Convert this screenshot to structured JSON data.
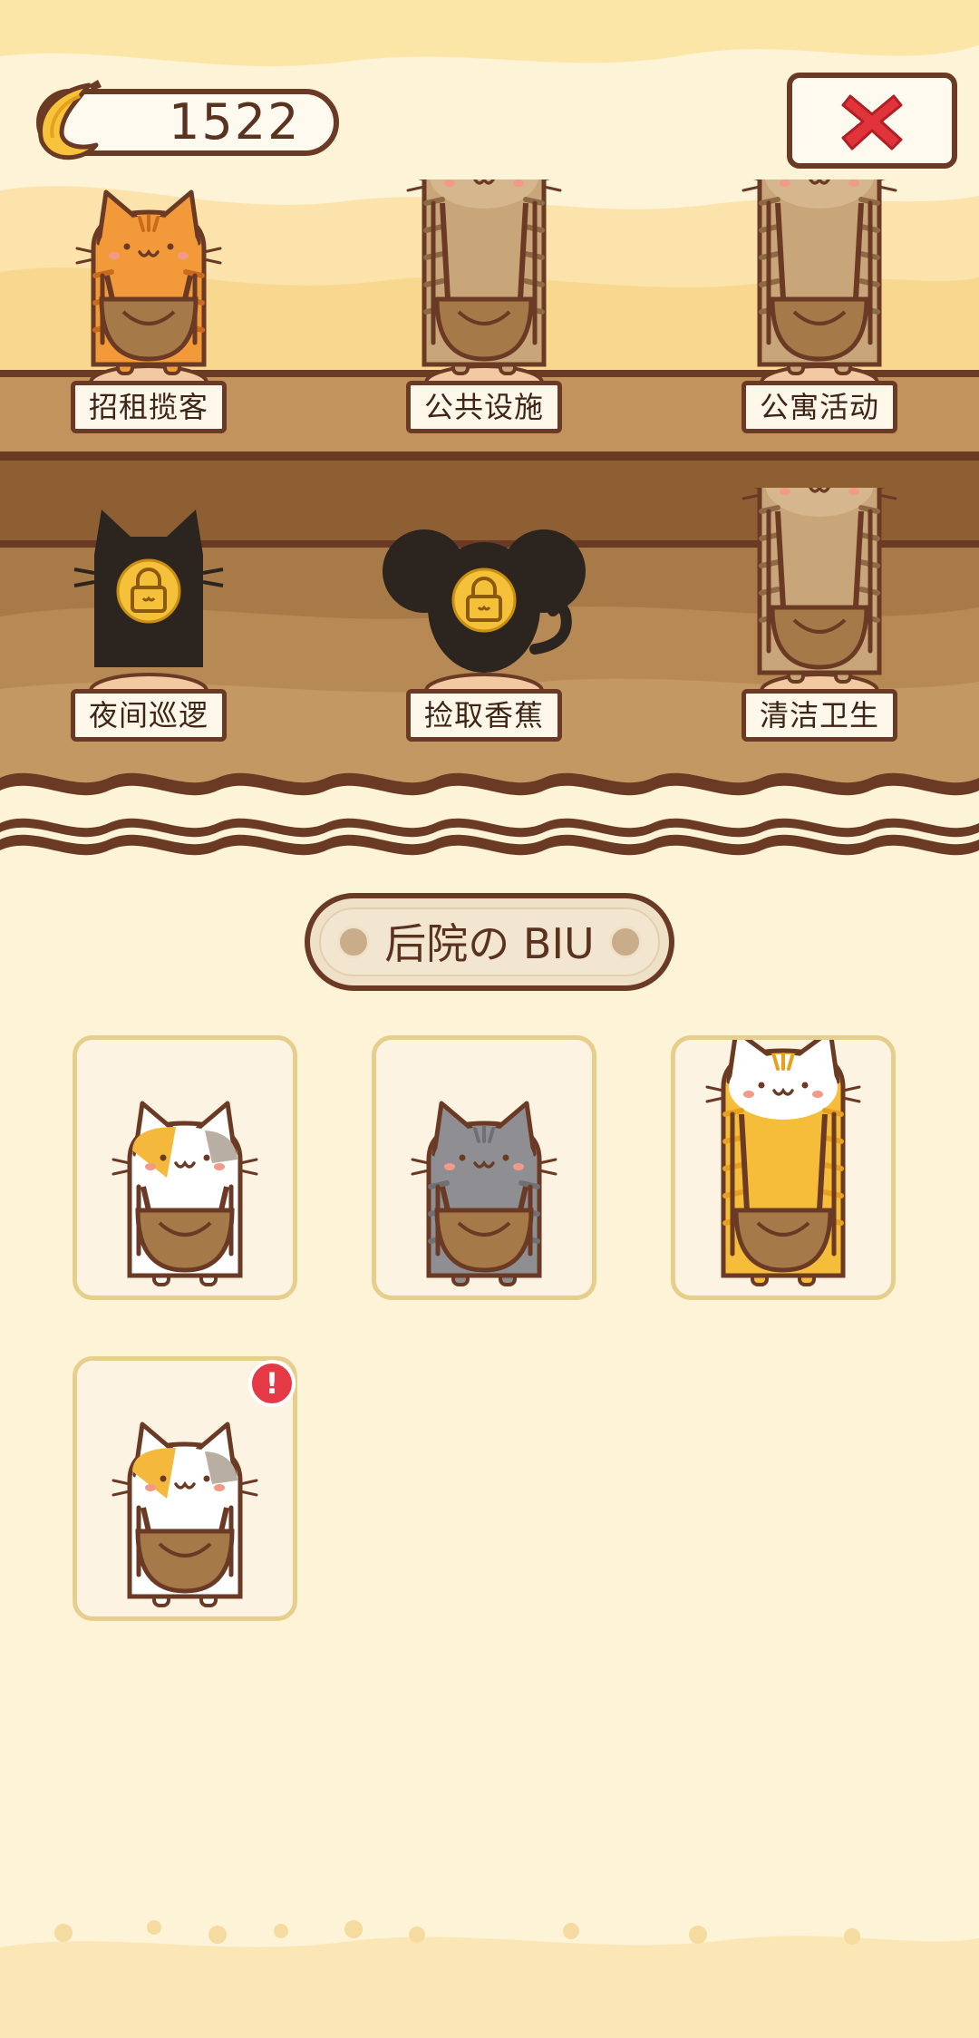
{
  "currency": {
    "icon": "banana-icon",
    "value": "1522"
  },
  "close_button": {
    "icon": "close-x-icon",
    "color": "#e0343a"
  },
  "jobs": [
    {
      "label": "招租揽客",
      "cat": "orange-tabby-cat",
      "locked": false
    },
    {
      "label": "公共设施",
      "cat": "brown-tabby-cat",
      "locked": false
    },
    {
      "label": "公寓活动",
      "cat": "brown-tabby-cat",
      "locked": false
    },
    {
      "label": "夜间巡逻",
      "cat": "silhouette-cat",
      "locked": true
    },
    {
      "label": "捡取香蕉",
      "cat": "silhouette-mouse",
      "locked": true
    },
    {
      "label": "清洁卫生",
      "cat": "brown-tabby-cat",
      "locked": false
    }
  ],
  "section": {
    "title": "后院の BIU"
  },
  "backyard_cats": [
    {
      "cat": "calico-cat",
      "alert": false
    },
    {
      "cat": "gray-cat",
      "alert": false
    },
    {
      "cat": "orange-white-cat",
      "alert": false
    },
    {
      "cat": "calico-cat",
      "alert": true,
      "alert_text": "!"
    }
  ],
  "colors": {
    "background": "#fdf3d6",
    "outline": "#6b3a24",
    "card_border": "#e6cf8c",
    "alert": "#e63946"
  }
}
